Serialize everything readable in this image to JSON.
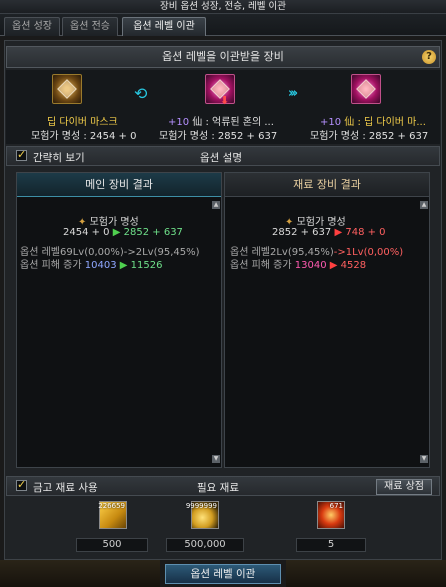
{
  "window": {
    "title": "장비 옵션 성장, 전승, 레벨 이관"
  },
  "tabs": [
    {
      "label": "옵션 성장",
      "active": false
    },
    {
      "label": "옵션 전승",
      "active": false
    },
    {
      "label": "옵션 레벨 이관",
      "active": true
    }
  ],
  "header": {
    "title": "옵션 레벨을 이관받을 장비",
    "help": "?"
  },
  "items": {
    "left": {
      "name": "딥 다이버 마스크",
      "stat": "모험가 명성 : 2454 + 0"
    },
    "middle": {
      "plus": "+10",
      "name": "仙 : 억류된 혼의 ...",
      "stat": "모험가 명성 : 2852 + 637"
    },
    "right": {
      "plus": "+10",
      "name": "仙 : 딥 다이버 마...",
      "stat": "모험가 명성 : 2852 + 637"
    }
  },
  "options": {
    "brief_label": "간략히 보기",
    "section_label": "옵션 설명"
  },
  "main_result": {
    "header": "메인 장비 결과",
    "fame_label": "모험가 명성",
    "fame_before": "2454 + 0",
    "fame_after": "2852 + 637",
    "level_line": "옵션 레벨69Lv(0,00%)->2Lv(95,45%)",
    "dmg_label": "옵션 피해 증가",
    "dmg_before": "10403",
    "dmg_after": "11526"
  },
  "material_result": {
    "header": "재료 장비 결과",
    "fame_label": "모험가 명성",
    "fame_before": "2852 + 637",
    "fame_after": "748 + 0",
    "level_line_a": "옵션 레벨2Lv(95,45%)",
    "level_line_b": "->1Lv(0,00%)",
    "dmg_label": "옵션 피해 증가",
    "dmg_before": "13040",
    "dmg_after": "4528"
  },
  "bottom": {
    "gold_label": "금고 재료 사용",
    "required_label": "필요 재료",
    "shop_button": "재료 상점",
    "materials": [
      {
        "icon": "gold-crystal-icon",
        "count": "226659",
        "required": "500"
      },
      {
        "icon": "gold-coins-icon",
        "count": "9999999",
        "required": "500,000"
      },
      {
        "icon": "fire-orb-icon",
        "count": "671",
        "required": "5"
      }
    ],
    "main_button": "옵션 레벨 이관"
  }
}
